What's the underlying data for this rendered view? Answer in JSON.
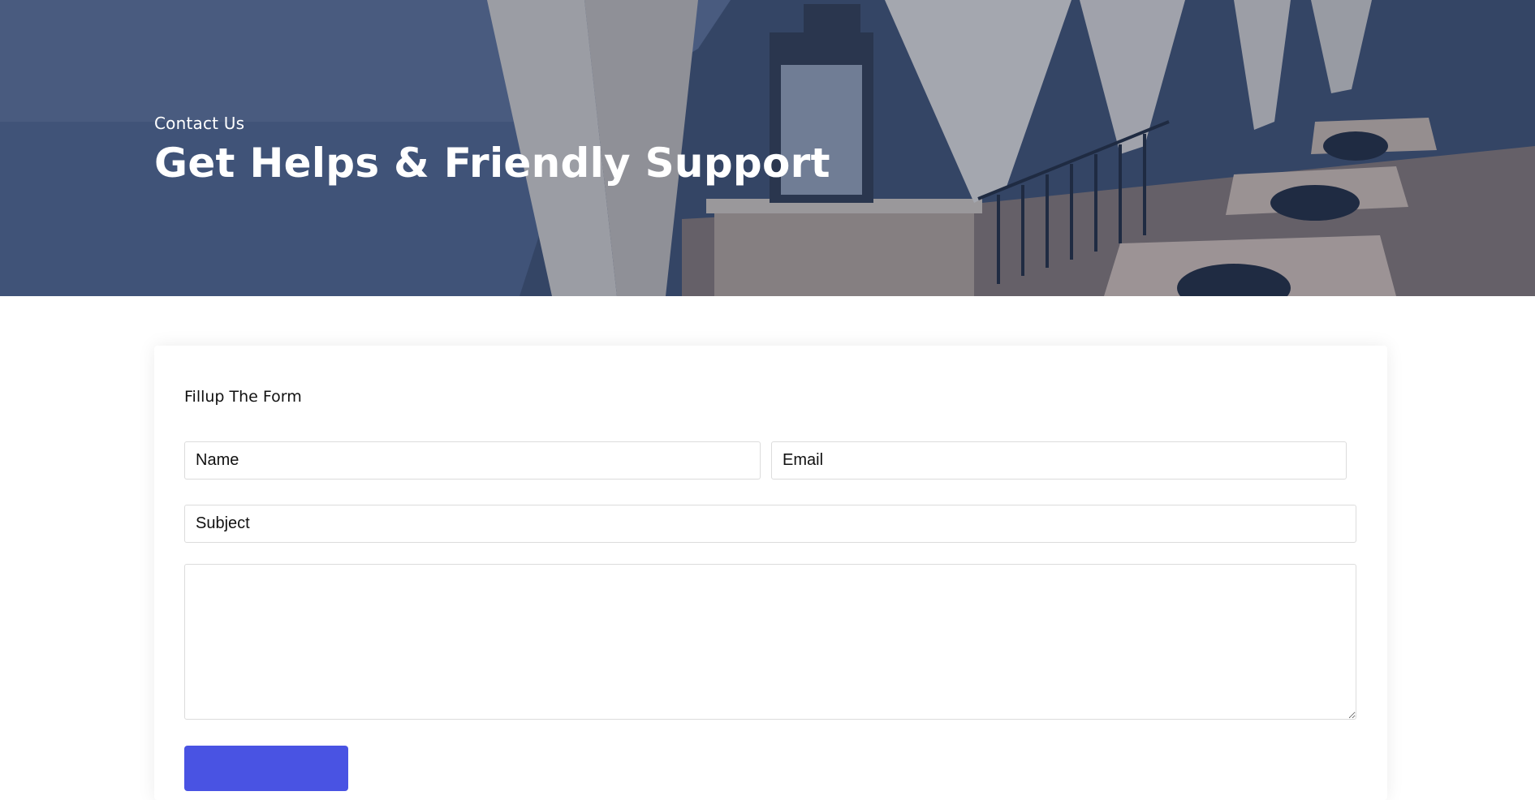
{
  "hero": {
    "eyebrow": "Contact Us",
    "title": "Get Helps & Friendly Support",
    "overlay_color": "#3f5278"
  },
  "form": {
    "title": "Fillup The Form",
    "name_placeholder": "Name",
    "email_placeholder": "Email",
    "subject_placeholder": "Subject",
    "message_placeholder": "",
    "submit_label": "",
    "accent_color": "#4953e3"
  }
}
